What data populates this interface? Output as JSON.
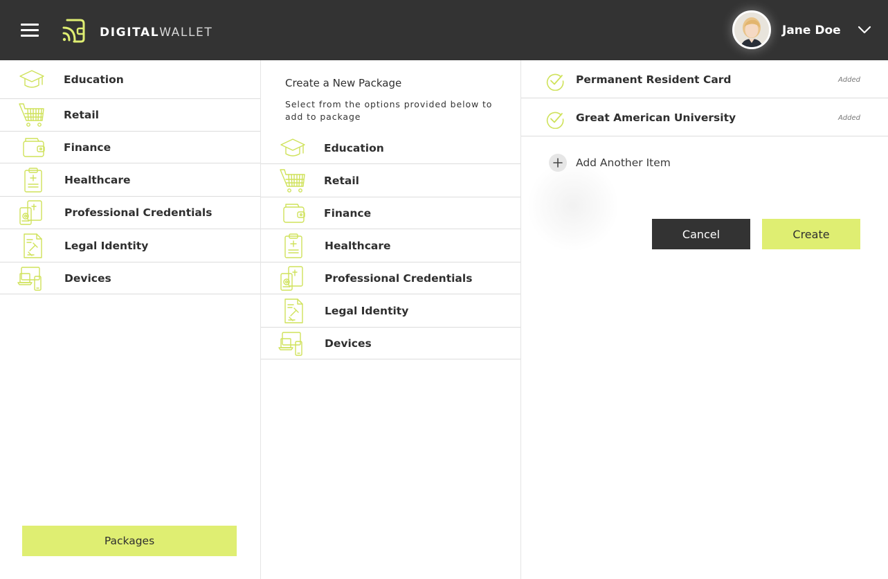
{
  "header": {
    "brand_bold": "DIGITAL",
    "brand_light": "WALLET",
    "user_name": "Jane Doe",
    "accent_color": "#dfee72"
  },
  "sidebar": {
    "items": [
      {
        "label": "Education",
        "icon": "graduation-cap-icon"
      },
      {
        "label": "Retail",
        "icon": "shopping-cart-icon"
      },
      {
        "label": "Finance",
        "icon": "wallet-icon"
      },
      {
        "label": "Healthcare",
        "icon": "medical-clipboard-icon"
      },
      {
        "label": "Professional Credentials",
        "icon": "credentials-icon"
      },
      {
        "label": "Legal Identity",
        "icon": "gavel-document-icon"
      },
      {
        "label": "Devices",
        "icon": "devices-icon"
      }
    ],
    "packages_label": "Packages"
  },
  "create_panel": {
    "title": "Create a New Package",
    "subtitle": "Select from the options provided below to add to package",
    "items": [
      {
        "label": "Education",
        "icon": "graduation-cap-icon"
      },
      {
        "label": "Retail",
        "icon": "shopping-cart-icon"
      },
      {
        "label": "Finance",
        "icon": "wallet-icon"
      },
      {
        "label": "Healthcare",
        "icon": "medical-clipboard-icon"
      },
      {
        "label": "Professional Credentials",
        "icon": "credentials-icon"
      },
      {
        "label": "Legal Identity",
        "icon": "gavel-document-icon"
      },
      {
        "label": "Devices",
        "icon": "devices-icon"
      }
    ]
  },
  "package_panel": {
    "added_items": [
      {
        "name": "Permanent Resident Card",
        "status": "Added"
      },
      {
        "name": "Great American University",
        "status": "Added"
      }
    ],
    "add_another_label": "Add Another Item",
    "cancel_label": "Cancel",
    "create_label": "Create"
  }
}
